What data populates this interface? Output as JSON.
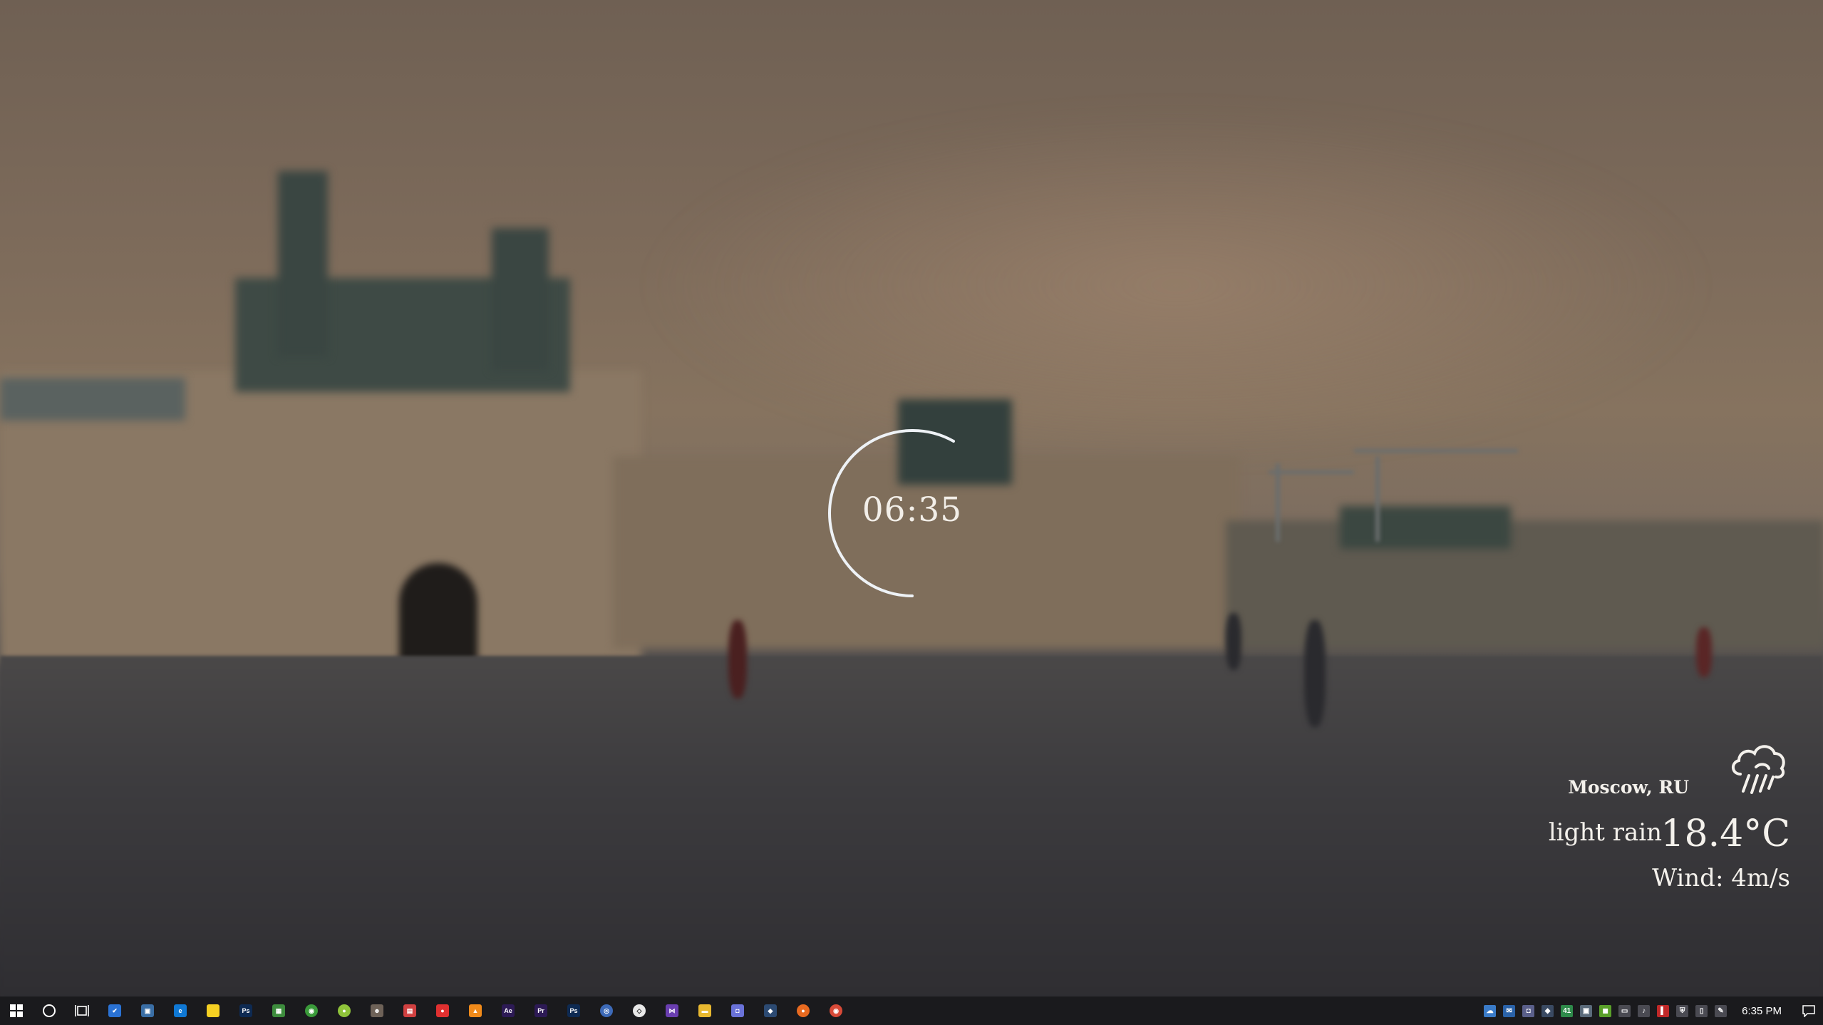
{
  "clock": {
    "time": "06:35"
  },
  "weather": {
    "location": "Moscow, RU",
    "condition": "light rain",
    "temperature": "18.4°C",
    "wind": "Wind: 4m/s",
    "icon": "rain-cloud-icon"
  },
  "taskbar": {
    "start_icon": "windows-start-icon",
    "search_icon": "cortana-circle-icon",
    "task_view_icon": "task-view-icon",
    "apps": [
      {
        "name": "todo-app-icon",
        "label": "✔",
        "color": "#2a72d4"
      },
      {
        "name": "remote-desktop-icon",
        "label": "▣",
        "color": "#3a6ea5"
      },
      {
        "name": "edge-browser-icon",
        "label": "e",
        "color": "#0f78d4"
      },
      {
        "name": "sticky-notes-icon",
        "label": "",
        "color": "#f5d022"
      },
      {
        "name": "photoshop-icon-1",
        "label": "Ps",
        "color": "#0e2a52"
      },
      {
        "name": "photos-app-icon",
        "label": "▦",
        "color": "#3d8c3d"
      },
      {
        "name": "spotify-like-icon",
        "label": "◉",
        "color": "#3a9a3a"
      },
      {
        "name": "green-circle-app-icon",
        "label": "●",
        "color": "#8fc33a"
      },
      {
        "name": "gimp-icon",
        "label": "☻",
        "color": "#6e6258"
      },
      {
        "name": "notepad-icon",
        "label": "▤",
        "color": "#d04040"
      },
      {
        "name": "red-app-icon",
        "label": "●",
        "color": "#e03030"
      },
      {
        "name": "vlc-icon",
        "label": "▲",
        "color": "#f08a1a"
      },
      {
        "name": "after-effects-icon",
        "label": "Ae",
        "color": "#2d1a55"
      },
      {
        "name": "premiere-icon",
        "label": "Pr",
        "color": "#2d1a55"
      },
      {
        "name": "photoshop-icon-2",
        "label": "Ps",
        "color": "#0e2a52"
      },
      {
        "name": "blue-circle-app-icon",
        "label": "◎",
        "color": "#3d6ab8"
      },
      {
        "name": "unity-icon",
        "label": "◇",
        "color": "#e8e8e8"
      },
      {
        "name": "visual-studio-icon",
        "label": "⋈",
        "color": "#6a3eb0"
      },
      {
        "name": "file-explorer-icon",
        "label": "▬",
        "color": "#e8b830"
      },
      {
        "name": "discord-icon",
        "label": "◘",
        "color": "#6a72d8"
      },
      {
        "name": "steam-icon",
        "label": "◆",
        "color": "#2c4a72"
      },
      {
        "name": "firefox-icon",
        "label": "●",
        "color": "#e86a20"
      },
      {
        "name": "chrome-icon",
        "label": "◉",
        "color": "#d84a38"
      }
    ],
    "tray": [
      {
        "name": "onedrive-tray-icon",
        "label": "☁",
        "color": "#3a7bc8"
      },
      {
        "name": "mail-tray-icon",
        "label": "✉",
        "color": "#2a62a8"
      },
      {
        "name": "discord-tray-icon",
        "label": "◘",
        "color": "#5a5f8a"
      },
      {
        "name": "steam-tray-icon",
        "label": "◆",
        "color": "#3a4a62"
      },
      {
        "name": "app-41-tray-icon",
        "label": "41",
        "color": "#2e8a4a"
      },
      {
        "name": "network-tray-icon",
        "label": "▣",
        "color": "#5a6a7a"
      },
      {
        "name": "nvidia-tray-icon",
        "label": "◼",
        "color": "#5aa02a"
      },
      {
        "name": "display-tray-icon",
        "label": "▭",
        "color": "#4a4a52"
      },
      {
        "name": "volume-tray-icon",
        "label": "♪",
        "color": "#4a4a52"
      },
      {
        "name": "red-tray-icon",
        "label": "▌",
        "color": "#c02828"
      },
      {
        "name": "shield-tray-icon",
        "label": "⛨",
        "color": "#4a4a52"
      },
      {
        "name": "usb-tray-icon",
        "label": "▯",
        "color": "#4a4a52"
      },
      {
        "name": "pen-tray-icon",
        "label": "✎",
        "color": "#4a4a52"
      }
    ],
    "time": "6:35 PM",
    "notifications_icon": "action-center-icon"
  }
}
